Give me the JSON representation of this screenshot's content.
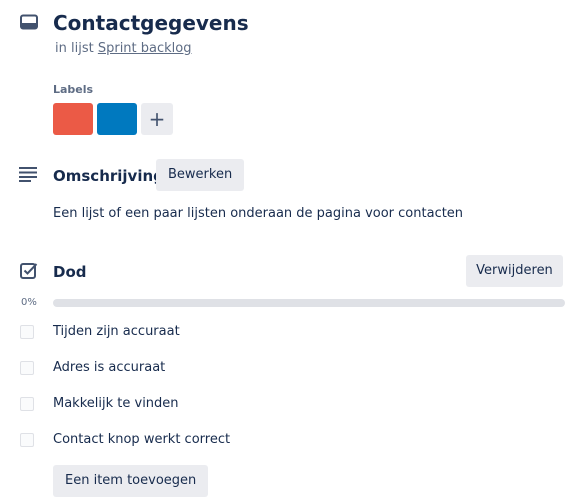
{
  "card": {
    "title": "Contactgegevens",
    "in_list_prefix": "in lijst",
    "list_name": "Sprint backlog"
  },
  "labels": {
    "heading": "Labels",
    "chips": [
      {
        "color": "#eb5a46"
      },
      {
        "color": "#0079bf"
      }
    ],
    "add_symbol": "+"
  },
  "description": {
    "title": "Omschrijving",
    "edit_label": "Bewerken",
    "text": "Een lijst of een paar lijsten onderaan de pagina voor contacten"
  },
  "checklist": {
    "title": "Dod",
    "delete_label": "Verwijderen",
    "progress_text": "0%",
    "progress_fraction": 0,
    "items": [
      {
        "text": "Tijden zijn accuraat",
        "checked": false
      },
      {
        "text": "Adres is accuraat",
        "checked": false
      },
      {
        "text": "Makkelijk te vinden",
        "checked": false
      },
      {
        "text": "Contact knop werkt correct",
        "checked": false
      }
    ],
    "add_item_label": "Een item toevoegen"
  },
  "icons": {
    "card": "card-icon",
    "description": "description-icon",
    "checklist": "checklist-icon"
  }
}
